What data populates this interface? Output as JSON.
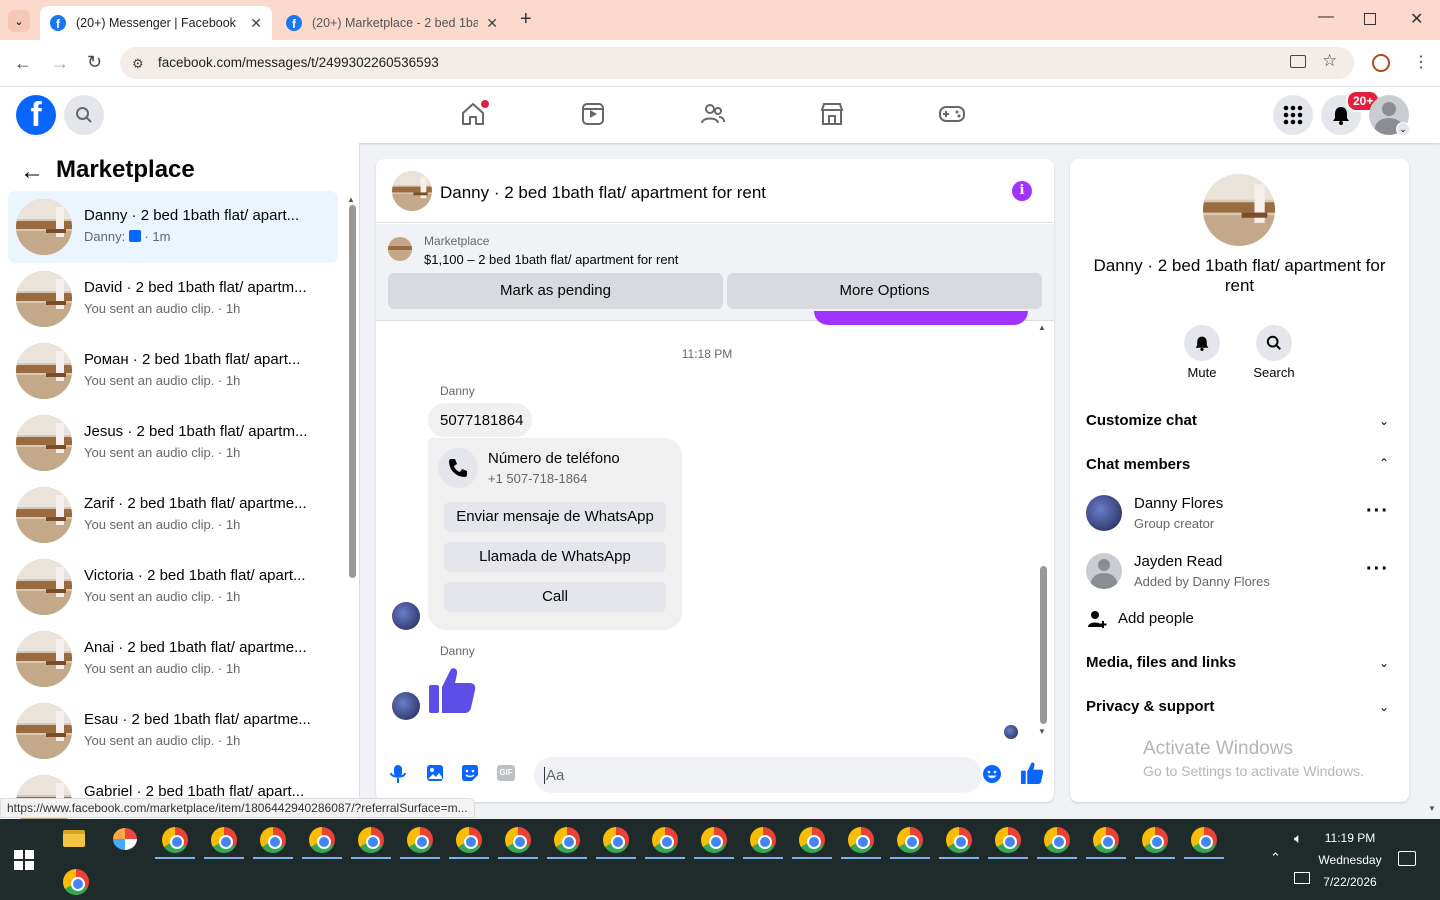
{
  "browser": {
    "tabs": [
      {
        "title": "(20+) Messenger | Facebook",
        "active": true
      },
      {
        "title": "(20+) Marketplace - 2 bed 1bat",
        "active": false
      }
    ],
    "url": "facebook.com/messages/t/2499302260536593",
    "status_url": "https://www.facebook.com/marketplace/item/1806442940286087/?referralSurface=m..."
  },
  "header": {
    "logo": "f",
    "notifications_badge": "20+",
    "nav": [
      "home-icon",
      "video-icon",
      "friends-icon",
      "marketplace-icon",
      "gaming-icon"
    ]
  },
  "sidebar": {
    "title": "Marketplace",
    "conversations": [
      {
        "name": "Danny · 2 bed 1bath flat/ apart...",
        "preview": "Danny:",
        "time": "· 1m",
        "selected": true
      },
      {
        "name": "David · 2 bed 1bath flat/ apartm...",
        "preview": "You sent an audio clip. · 1h"
      },
      {
        "name": "Роман · 2 bed 1bath flat/ apart...",
        "preview": "You sent an audio clip. · 1h"
      },
      {
        "name": "Jesus · 2 bed 1bath flat/ apartm...",
        "preview": "You sent an audio clip. · 1h"
      },
      {
        "name": "Zarif · 2 bed 1bath flat/ apartme...",
        "preview": "You sent an audio clip. · 1h"
      },
      {
        "name": "Victoria · 2 bed 1bath flat/ apart...",
        "preview": "You sent an audio clip. · 1h"
      },
      {
        "name": "Anai · 2 bed 1bath flat/ apartme...",
        "preview": "You sent an audio clip. · 1h"
      },
      {
        "name": "Esau · 2 bed 1bath flat/ apartme...",
        "preview": "You sent an audio clip. · 1h"
      },
      {
        "name": "Gabriel · 2 bed 1bath flat/ apart...",
        "preview": ""
      }
    ]
  },
  "chat": {
    "title": "Danny · 2 bed 1bath flat/ apartment for rent",
    "listing": {
      "source": "Marketplace",
      "summary": "$1,100 – 2 bed 1bath flat/ apartment for rent",
      "mark_pending": "Mark as pending",
      "more_options": "More Options"
    },
    "timestamp": "11:18 PM",
    "sender": "Danny",
    "phone_message": "5077181864",
    "phone_card": {
      "title": "Número de teléfono",
      "number": "+1 507-718-1864",
      "whatsapp_message": "Enviar mensaje de WhatsApp",
      "whatsapp_call": "Llamada de WhatsApp",
      "call": "Call"
    },
    "sender2": "Danny",
    "composer_placeholder": "Aa"
  },
  "info": {
    "title": "Danny · 2 bed 1bath flat/ apartment for rent",
    "mute": "Mute",
    "search": "Search",
    "customize": "Customize chat",
    "members_label": "Chat members",
    "members": [
      {
        "name": "Danny Flores",
        "role": "Group creator"
      },
      {
        "name": "Jayden Read",
        "role": "Added by Danny Flores"
      }
    ],
    "add_people": "Add people",
    "media": "Media, files and links",
    "privacy": "Privacy & support",
    "watermark_title": "Activate Windows",
    "watermark_sub": "Go to Settings to activate Windows."
  },
  "taskbar": {
    "time": "11:19 PM",
    "day": "Wednesday",
    "date": "7/22/2026"
  },
  "colors": {
    "accent": "#0866ff",
    "messenger_purple": "#a033ff",
    "thumb": "#5b4de6"
  }
}
